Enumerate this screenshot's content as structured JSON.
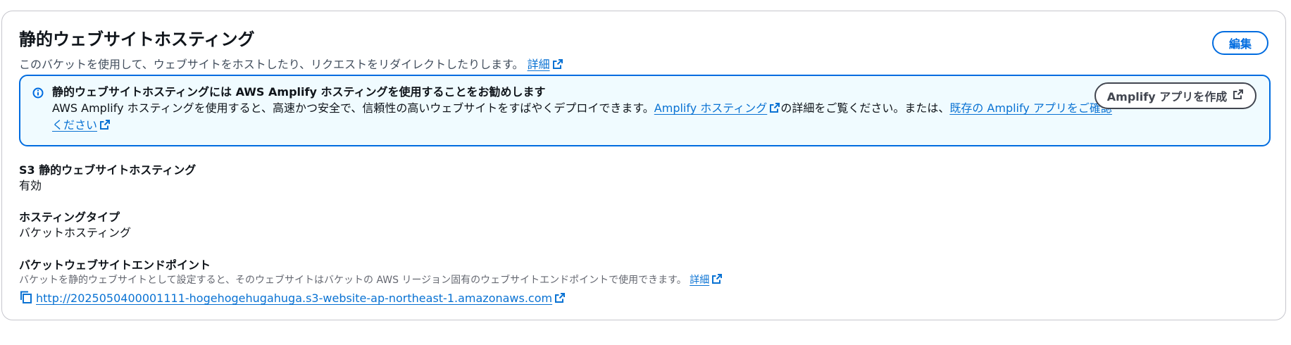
{
  "header": {
    "title": "静的ウェブサイトホスティング",
    "description": "このバケットを使用して、ウェブサイトをホストしたり、リクエストをリダイレクトしたりします。",
    "details_link": "詳細",
    "edit_button": "編集"
  },
  "alert": {
    "title": "静的ウェブサイトホスティングには AWS Amplify ホスティングを使用することをお勧めします",
    "body_prefix": "AWS Amplify ホスティングを使用すると、高速かつ安全で、信頼性の高いウェブサイトをすばやくデプロイできます。",
    "link1": "Amplify ホスティング",
    "body_middle": "の詳細をご覧ください。または、",
    "link2": "既存の Amplify アプリをご確認ください",
    "button": "Amplify アプリを作成"
  },
  "fields": {
    "hosting": {
      "label": "S3 静的ウェブサイトホスティング",
      "value": "有効"
    },
    "hosting_type": {
      "label": "ホスティングタイプ",
      "value": "バケットホスティング"
    },
    "endpoint": {
      "label": "バケットウェブサイトエンドポイント",
      "description": "バケットを静的ウェブサイトとして設定すると、そのウェブサイトはバケットの AWS リージョン固有のウェブサイトエンドポイントで使用できます。",
      "details_link": "詳細",
      "url": "http://2025050400001111-hogehogehugahuga.s3-website-ap-northeast-1.amazonaws.com"
    }
  },
  "icons": {
    "info": "info-icon",
    "external": "external-link-icon",
    "copy": "copy-icon"
  },
  "colors": {
    "link": "#0972d3",
    "primary": "#006ce0",
    "alert_bg": "#f0fbff",
    "text": "#0f141a",
    "secondary_text": "#656871"
  }
}
